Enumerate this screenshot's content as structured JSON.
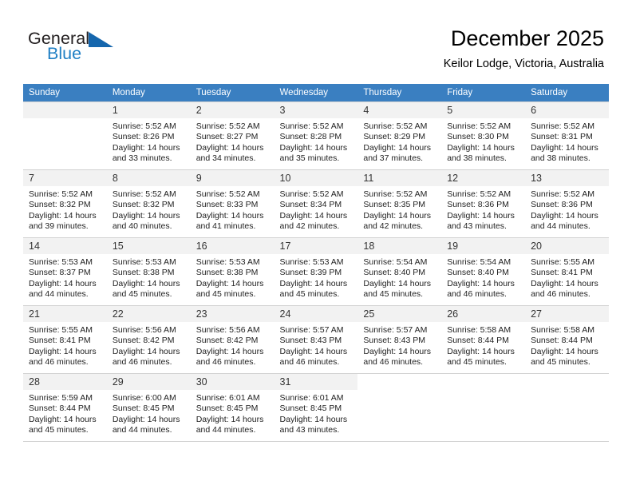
{
  "brand": {
    "name_part1": "General",
    "name_part2": "Blue",
    "triangle_color": "#1566ad",
    "blue_color": "#1f7fc4"
  },
  "header": {
    "title": "December 2025",
    "location": "Keilor Lodge, Victoria, Australia"
  },
  "calendar": {
    "header_bg": "#3a7fc1",
    "daynum_bg": "#f2f2f2",
    "weekdays": [
      "Sunday",
      "Monday",
      "Tuesday",
      "Wednesday",
      "Thursday",
      "Friday",
      "Saturday"
    ],
    "weeks": [
      [
        {
          "day": "",
          "sunrise": "",
          "sunset": "",
          "daylight1": "",
          "daylight2": "",
          "empty": true
        },
        {
          "day": "1",
          "sunrise": "Sunrise: 5:52 AM",
          "sunset": "Sunset: 8:26 PM",
          "daylight1": "Daylight: 14 hours",
          "daylight2": "and 33 minutes."
        },
        {
          "day": "2",
          "sunrise": "Sunrise: 5:52 AM",
          "sunset": "Sunset: 8:27 PM",
          "daylight1": "Daylight: 14 hours",
          "daylight2": "and 34 minutes."
        },
        {
          "day": "3",
          "sunrise": "Sunrise: 5:52 AM",
          "sunset": "Sunset: 8:28 PM",
          "daylight1": "Daylight: 14 hours",
          "daylight2": "and 35 minutes."
        },
        {
          "day": "4",
          "sunrise": "Sunrise: 5:52 AM",
          "sunset": "Sunset: 8:29 PM",
          "daylight1": "Daylight: 14 hours",
          "daylight2": "and 37 minutes."
        },
        {
          "day": "5",
          "sunrise": "Sunrise: 5:52 AM",
          "sunset": "Sunset: 8:30 PM",
          "daylight1": "Daylight: 14 hours",
          "daylight2": "and 38 minutes."
        },
        {
          "day": "6",
          "sunrise": "Sunrise: 5:52 AM",
          "sunset": "Sunset: 8:31 PM",
          "daylight1": "Daylight: 14 hours",
          "daylight2": "and 38 minutes."
        }
      ],
      [
        {
          "day": "7",
          "sunrise": "Sunrise: 5:52 AM",
          "sunset": "Sunset: 8:32 PM",
          "daylight1": "Daylight: 14 hours",
          "daylight2": "and 39 minutes."
        },
        {
          "day": "8",
          "sunrise": "Sunrise: 5:52 AM",
          "sunset": "Sunset: 8:32 PM",
          "daylight1": "Daylight: 14 hours",
          "daylight2": "and 40 minutes."
        },
        {
          "day": "9",
          "sunrise": "Sunrise: 5:52 AM",
          "sunset": "Sunset: 8:33 PM",
          "daylight1": "Daylight: 14 hours",
          "daylight2": "and 41 minutes."
        },
        {
          "day": "10",
          "sunrise": "Sunrise: 5:52 AM",
          "sunset": "Sunset: 8:34 PM",
          "daylight1": "Daylight: 14 hours",
          "daylight2": "and 42 minutes."
        },
        {
          "day": "11",
          "sunrise": "Sunrise: 5:52 AM",
          "sunset": "Sunset: 8:35 PM",
          "daylight1": "Daylight: 14 hours",
          "daylight2": "and 42 minutes."
        },
        {
          "day": "12",
          "sunrise": "Sunrise: 5:52 AM",
          "sunset": "Sunset: 8:36 PM",
          "daylight1": "Daylight: 14 hours",
          "daylight2": "and 43 minutes."
        },
        {
          "day": "13",
          "sunrise": "Sunrise: 5:52 AM",
          "sunset": "Sunset: 8:36 PM",
          "daylight1": "Daylight: 14 hours",
          "daylight2": "and 44 minutes."
        }
      ],
      [
        {
          "day": "14",
          "sunrise": "Sunrise: 5:53 AM",
          "sunset": "Sunset: 8:37 PM",
          "daylight1": "Daylight: 14 hours",
          "daylight2": "and 44 minutes."
        },
        {
          "day": "15",
          "sunrise": "Sunrise: 5:53 AM",
          "sunset": "Sunset: 8:38 PM",
          "daylight1": "Daylight: 14 hours",
          "daylight2": "and 45 minutes."
        },
        {
          "day": "16",
          "sunrise": "Sunrise: 5:53 AM",
          "sunset": "Sunset: 8:38 PM",
          "daylight1": "Daylight: 14 hours",
          "daylight2": "and 45 minutes."
        },
        {
          "day": "17",
          "sunrise": "Sunrise: 5:53 AM",
          "sunset": "Sunset: 8:39 PM",
          "daylight1": "Daylight: 14 hours",
          "daylight2": "and 45 minutes."
        },
        {
          "day": "18",
          "sunrise": "Sunrise: 5:54 AM",
          "sunset": "Sunset: 8:40 PM",
          "daylight1": "Daylight: 14 hours",
          "daylight2": "and 45 minutes."
        },
        {
          "day": "19",
          "sunrise": "Sunrise: 5:54 AM",
          "sunset": "Sunset: 8:40 PM",
          "daylight1": "Daylight: 14 hours",
          "daylight2": "and 46 minutes."
        },
        {
          "day": "20",
          "sunrise": "Sunrise: 5:55 AM",
          "sunset": "Sunset: 8:41 PM",
          "daylight1": "Daylight: 14 hours",
          "daylight2": "and 46 minutes."
        }
      ],
      [
        {
          "day": "21",
          "sunrise": "Sunrise: 5:55 AM",
          "sunset": "Sunset: 8:41 PM",
          "daylight1": "Daylight: 14 hours",
          "daylight2": "and 46 minutes."
        },
        {
          "day": "22",
          "sunrise": "Sunrise: 5:56 AM",
          "sunset": "Sunset: 8:42 PM",
          "daylight1": "Daylight: 14 hours",
          "daylight2": "and 46 minutes."
        },
        {
          "day": "23",
          "sunrise": "Sunrise: 5:56 AM",
          "sunset": "Sunset: 8:42 PM",
          "daylight1": "Daylight: 14 hours",
          "daylight2": "and 46 minutes."
        },
        {
          "day": "24",
          "sunrise": "Sunrise: 5:57 AM",
          "sunset": "Sunset: 8:43 PM",
          "daylight1": "Daylight: 14 hours",
          "daylight2": "and 46 minutes."
        },
        {
          "day": "25",
          "sunrise": "Sunrise: 5:57 AM",
          "sunset": "Sunset: 8:43 PM",
          "daylight1": "Daylight: 14 hours",
          "daylight2": "and 46 minutes."
        },
        {
          "day": "26",
          "sunrise": "Sunrise: 5:58 AM",
          "sunset": "Sunset: 8:44 PM",
          "daylight1": "Daylight: 14 hours",
          "daylight2": "and 45 minutes."
        },
        {
          "day": "27",
          "sunrise": "Sunrise: 5:58 AM",
          "sunset": "Sunset: 8:44 PM",
          "daylight1": "Daylight: 14 hours",
          "daylight2": "and 45 minutes."
        }
      ],
      [
        {
          "day": "28",
          "sunrise": "Sunrise: 5:59 AM",
          "sunset": "Sunset: 8:44 PM",
          "daylight1": "Daylight: 14 hours",
          "daylight2": "and 45 minutes."
        },
        {
          "day": "29",
          "sunrise": "Sunrise: 6:00 AM",
          "sunset": "Sunset: 8:45 PM",
          "daylight1": "Daylight: 14 hours",
          "daylight2": "and 44 minutes."
        },
        {
          "day": "30",
          "sunrise": "Sunrise: 6:01 AM",
          "sunset": "Sunset: 8:45 PM",
          "daylight1": "Daylight: 14 hours",
          "daylight2": "and 44 minutes."
        },
        {
          "day": "31",
          "sunrise": "Sunrise: 6:01 AM",
          "sunset": "Sunset: 8:45 PM",
          "daylight1": "Daylight: 14 hours",
          "daylight2": "and 43 minutes."
        },
        {
          "day": "",
          "sunrise": "",
          "sunset": "",
          "daylight1": "",
          "daylight2": "",
          "empty": true,
          "nofill": true
        },
        {
          "day": "",
          "sunrise": "",
          "sunset": "",
          "daylight1": "",
          "daylight2": "",
          "empty": true,
          "nofill": true
        },
        {
          "day": "",
          "sunrise": "",
          "sunset": "",
          "daylight1": "",
          "daylight2": "",
          "empty": true,
          "nofill": true
        }
      ]
    ]
  }
}
